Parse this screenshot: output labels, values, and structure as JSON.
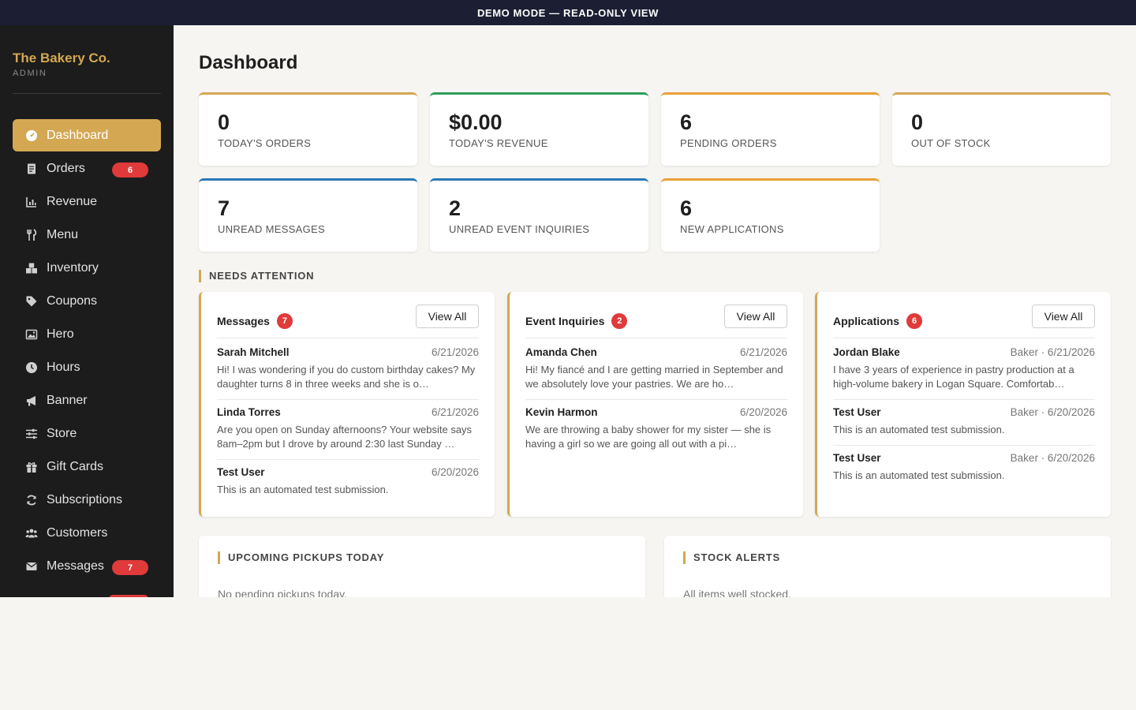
{
  "banner": {
    "text": "DEMO MODE — READ-ONLY VIEW"
  },
  "brand": {
    "name": "The Bakery Co.",
    "subtitle": "ADMIN"
  },
  "colors": {
    "accent": "#d4a853",
    "sidebar_bg": "#1c1c1c",
    "banner_bg": "#1c1f33",
    "badge": "#e03a3a",
    "green": "#2f9e5b",
    "blue": "#2b78b6",
    "orange": "#e8a13a"
  },
  "sidebar": {
    "items": [
      {
        "label": "Dashboard",
        "icon": "dashboard-icon",
        "active": true,
        "badge": ""
      },
      {
        "label": "Orders",
        "icon": "receipt-icon",
        "badge": "6"
      },
      {
        "label": "Revenue",
        "icon": "chart-icon",
        "badge": ""
      },
      {
        "label": "Menu",
        "icon": "utensils-icon",
        "badge": ""
      },
      {
        "label": "Inventory",
        "icon": "boxes-icon",
        "badge": ""
      },
      {
        "label": "Coupons",
        "icon": "tag-icon",
        "badge": ""
      },
      {
        "label": "Hero",
        "icon": "image-icon",
        "badge": ""
      },
      {
        "label": "Hours",
        "icon": "clock-icon",
        "badge": ""
      },
      {
        "label": "Banner",
        "icon": "megaphone-icon",
        "badge": ""
      },
      {
        "label": "Store",
        "icon": "sliders-icon",
        "badge": ""
      },
      {
        "label": "Gift Cards",
        "icon": "gift-icon",
        "badge": ""
      },
      {
        "label": "Subscriptions",
        "icon": "refresh-icon",
        "badge": ""
      },
      {
        "label": "Customers",
        "icon": "users-icon",
        "badge": ""
      },
      {
        "label": "Messages",
        "icon": "envelope-icon",
        "badge": "7"
      }
    ]
  },
  "page": {
    "title": "Dashboard"
  },
  "stats": [
    {
      "value": "0",
      "label": "TODAY'S ORDERS",
      "accent": "#d4a853"
    },
    {
      "value": "$0.00",
      "label": "TODAY'S REVENUE",
      "accent": "#2f9e5b"
    },
    {
      "value": "6",
      "label": "PENDING ORDERS",
      "accent": "#e8a13a"
    },
    {
      "value": "0",
      "label": "OUT OF STOCK",
      "accent": "#d4a853"
    },
    {
      "value": "7",
      "label": "UNREAD MESSAGES",
      "accent": "#2b78b6"
    },
    {
      "value": "2",
      "label": "UNREAD EVENT INQUIRIES",
      "accent": "#2b78b6"
    },
    {
      "value": "6",
      "label": "NEW APPLICATIONS",
      "accent": "#e8a13a"
    }
  ],
  "attention": {
    "heading": "NEEDS ATTENTION",
    "panels": [
      {
        "title": "Messages",
        "count": "7",
        "button": "View All",
        "entries": [
          {
            "name": "Sarah Mitchell",
            "meta": "6/21/2026",
            "text": "Hi! I was wondering if you do custom birthday cakes? My daughter turns 8 in three weeks and she is o…"
          },
          {
            "name": "Linda Torres",
            "meta": "6/21/2026",
            "text": "Are you open on Sunday afternoons? Your website says 8am–2pm but I drove by around 2:30 last Sunday …"
          },
          {
            "name": "Test User",
            "meta": "6/20/2026",
            "text": "This is an automated test submission."
          }
        ]
      },
      {
        "title": "Event Inquiries",
        "count": "2",
        "button": "View All",
        "entries": [
          {
            "name": "Amanda Chen",
            "meta": "6/21/2026",
            "text": "Hi! My fiancé and I are getting married in September and we absolutely love your pastries. We are ho…"
          },
          {
            "name": "Kevin Harmon",
            "meta": "6/20/2026",
            "text": "We are throwing a baby shower for my sister — she is having a girl so we are going all out with a pi…"
          }
        ]
      },
      {
        "title": "Applications",
        "count": "6",
        "button": "View All",
        "entries": [
          {
            "name": "Jordan Blake",
            "meta": "Baker · 6/21/2026",
            "text": "I have 3 years of experience in pastry production at a high-volume bakery in Logan Square. Comfortab…"
          },
          {
            "name": "Test User",
            "meta": "Baker · 6/20/2026",
            "text": "This is an automated test submission."
          },
          {
            "name": "Test User",
            "meta": "Baker · 6/20/2026",
            "text": "This is an automated test submission."
          }
        ]
      }
    ]
  },
  "pickups": {
    "heading": "UPCOMING PICKUPS TODAY",
    "empty": "No pending pickups today."
  },
  "stock": {
    "heading": "STOCK ALERTS",
    "empty": "All items well stocked."
  }
}
